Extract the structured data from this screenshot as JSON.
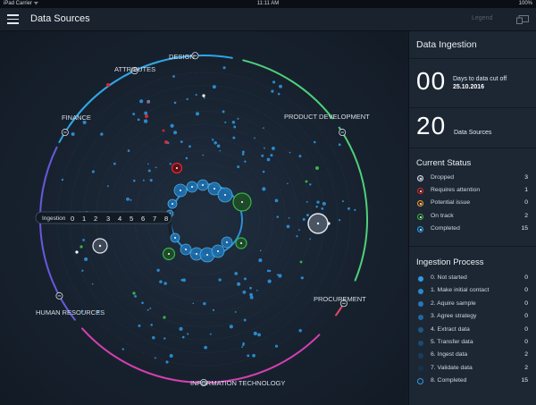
{
  "status_bar": {
    "carrier": "iPad Carrier ᯤ",
    "time": "11:11 AM",
    "battery": "100%"
  },
  "nav": {
    "title": "Data Sources",
    "legend_label": "Legend",
    "menu_icon": "hamburger-menu-icon",
    "screen_icon": "screen-mirror-icon"
  },
  "colors": {
    "accent_blue": "#2e9be6",
    "green": "#39b54a",
    "red": "#e0252e",
    "orange": "#f0a032",
    "pink": "#d53fb0",
    "white": "#ffffff"
  },
  "segments": [
    "DESIGN",
    "ATTRIBUTES",
    "FINANCE",
    "PRODUCT DEVELOPMENT",
    "HUMAN RESOURCES",
    "PROCUREMENT",
    "INFORMATION TECHNOLOGY"
  ],
  "ingestion_scale": {
    "label": "Ingestion",
    "numbers": [
      "0",
      "1",
      "2",
      "3",
      "4",
      "5",
      "6",
      "7",
      "8"
    ]
  },
  "panel": {
    "title": "Data Ingestion",
    "days_value": "00",
    "days_label": "Days to data cut off",
    "days_date": "25.10.2016",
    "sources_value": "20",
    "sources_label": "Data Sources",
    "status_title": "Current Status",
    "status": [
      {
        "label": "Dropped",
        "value": "3",
        "icon": "dropped-status-icon"
      },
      {
        "label": "Requires attention",
        "value": "1",
        "icon": "requires-attention-icon"
      },
      {
        "label": "Potential issue",
        "value": "0",
        "icon": "potential-issue-icon"
      },
      {
        "label": "On track",
        "value": "2",
        "icon": "on-track-icon"
      },
      {
        "label": "Completed",
        "value": "15",
        "icon": "completed-status-icon"
      }
    ],
    "process_title": "Ingestion Process",
    "process": [
      {
        "label": "0. Not started",
        "value": "0"
      },
      {
        "label": "1. Make initial contact",
        "value": "0"
      },
      {
        "label": "2. Aquire sample",
        "value": "0"
      },
      {
        "label": "3. Agree strategy",
        "value": "0"
      },
      {
        "label": "4. Extract data",
        "value": "0"
      },
      {
        "label": "5. Transfer data",
        "value": "0"
      },
      {
        "label": "6. Ingest data",
        "value": "2"
      },
      {
        "label": "7. Validate data",
        "value": "2"
      },
      {
        "label": "8. Completed",
        "value": "15"
      }
    ]
  }
}
